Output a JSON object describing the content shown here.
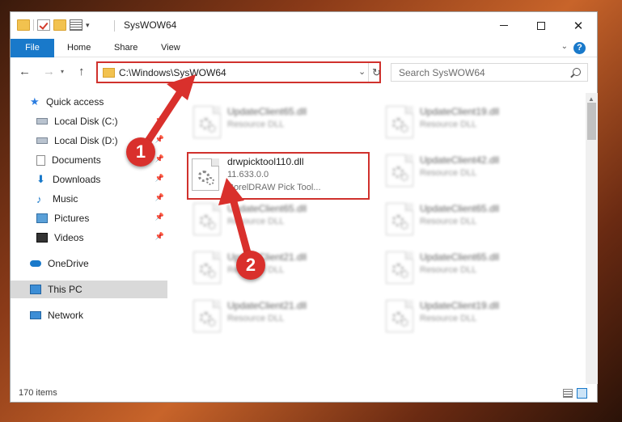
{
  "window": {
    "title": "SysWOW64"
  },
  "ribbon": {
    "tabs": [
      "File",
      "Home",
      "Share",
      "View"
    ],
    "help": "?"
  },
  "nav": {
    "address": "C:\\Windows\\SysWOW64",
    "search_placeholder": "Search SysWOW64"
  },
  "sidebar": {
    "items": [
      {
        "label": "Quick access",
        "icon": "star-icon"
      },
      {
        "label": "Local Disk (C:)",
        "icon": "disk-icon"
      },
      {
        "label": "Local Disk (D:)",
        "icon": "disk-icon"
      },
      {
        "label": "Documents",
        "icon": "documents-icon"
      },
      {
        "label": "Downloads",
        "icon": "download-icon"
      },
      {
        "label": "Music",
        "icon": "music-icon"
      },
      {
        "label": "Pictures",
        "icon": "pictures-icon"
      },
      {
        "label": "Videos",
        "icon": "videos-icon"
      },
      {
        "label": "OneDrive",
        "icon": "cloud-icon"
      },
      {
        "label": "This PC",
        "icon": "computer-icon",
        "selected": true
      },
      {
        "label": "Network",
        "icon": "network-icon"
      }
    ]
  },
  "files": {
    "highlighted": {
      "name": "drwpicktool110.dll",
      "version": "11.633.0.0",
      "description": "CorelDRAW Pick Tool..."
    },
    "background": [
      {
        "name": "UpdateClient65.dll",
        "type": "Resource DLL"
      },
      {
        "name": "UpdateClient19.dll",
        "type": "Resource DLL"
      },
      {
        "name": "UpdateClient42.dll",
        "type": "Resource DLL"
      },
      {
        "name": "UpdateClient65.dll",
        "type": "Resource DLL"
      },
      {
        "name": "UpdateClient65.dll",
        "type": "Resource DLL"
      },
      {
        "name": "UpdateClient21.dll",
        "type": "Resource DLL"
      },
      {
        "name": "UpdateClient65.dll",
        "type": "Resource DLL"
      },
      {
        "name": "UpdateClient21.dll",
        "type": "Resource DLL"
      },
      {
        "name": "UpdateClient19.dll",
        "type": "Resource DLL"
      }
    ]
  },
  "status": {
    "item_count": "170 items"
  },
  "annotations": {
    "step1": "1",
    "step2": "2",
    "color": "#d9302c"
  }
}
